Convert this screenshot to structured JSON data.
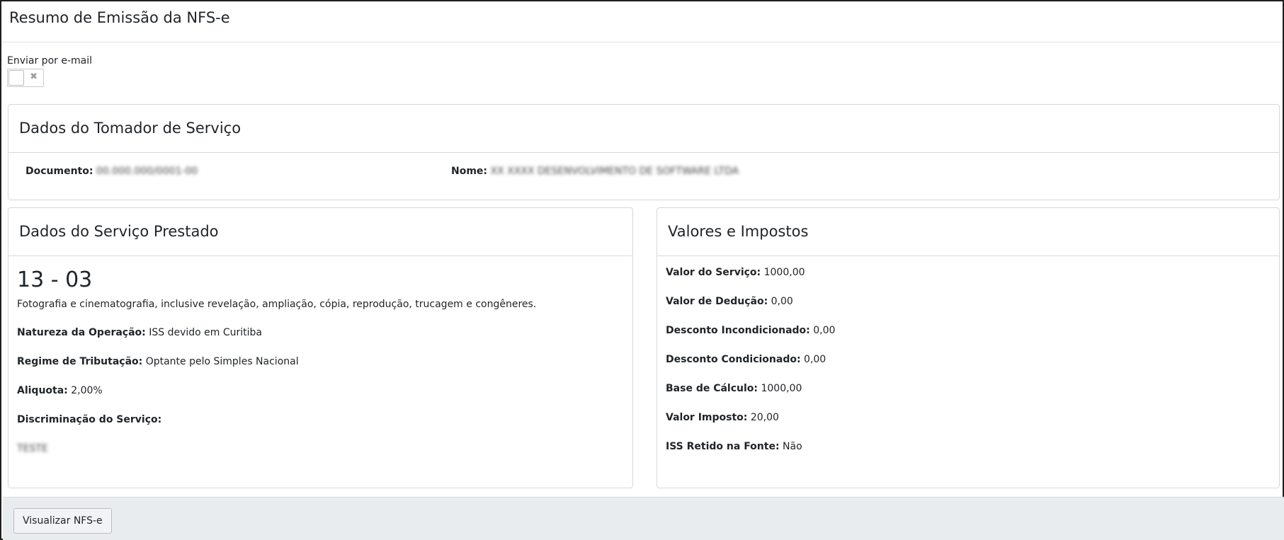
{
  "header": {
    "title": "Resumo de Emissão da NFS-e"
  },
  "email": {
    "label": "Enviar por e-mail",
    "toggle_icon": "✖"
  },
  "tomador": {
    "title": "Dados do Tomador de Serviço",
    "documento_label": "Documento:",
    "documento_value": "00.000.000/0001-00",
    "nome_label": "Nome:",
    "nome_value": "XX XXXX DESENVOLVIMENTO DE SOFTWARE LTDA"
  },
  "servico": {
    "title": "Dados do Serviço Prestado",
    "code": "13 - 03",
    "description": "Fotografia e cinematografia, inclusive revelação, ampliação, cópia, reprodução, trucagem e congêneres.",
    "natureza_label": "Natureza da Operação:",
    "natureza_value": "ISS devido em Curitiba",
    "regime_label": "Regime de Tributação:",
    "regime_value": "Optante pelo Simples Nacional",
    "aliquota_label": "Aliquota:",
    "aliquota_value": "2,00%",
    "discriminacao_label": "Discriminação do Serviço:",
    "discriminacao_value": "TESTE"
  },
  "valores": {
    "title": "Valores e Impostos",
    "items": [
      {
        "label": "Valor do Serviço:",
        "value": "1000,00"
      },
      {
        "label": "Valor de Dedução:",
        "value": "0,00"
      },
      {
        "label": "Desconto Incondicionado:",
        "value": "0,00"
      },
      {
        "label": "Desconto Condicionado:",
        "value": "0,00"
      },
      {
        "label": "Base de Cálculo:",
        "value": "1000,00"
      },
      {
        "label": "Valor Imposto:",
        "value": "20,00"
      },
      {
        "label": "ISS Retido na Fonte:",
        "value": "Não"
      }
    ]
  },
  "footer": {
    "button_label": "Visualizar NFS-e"
  }
}
